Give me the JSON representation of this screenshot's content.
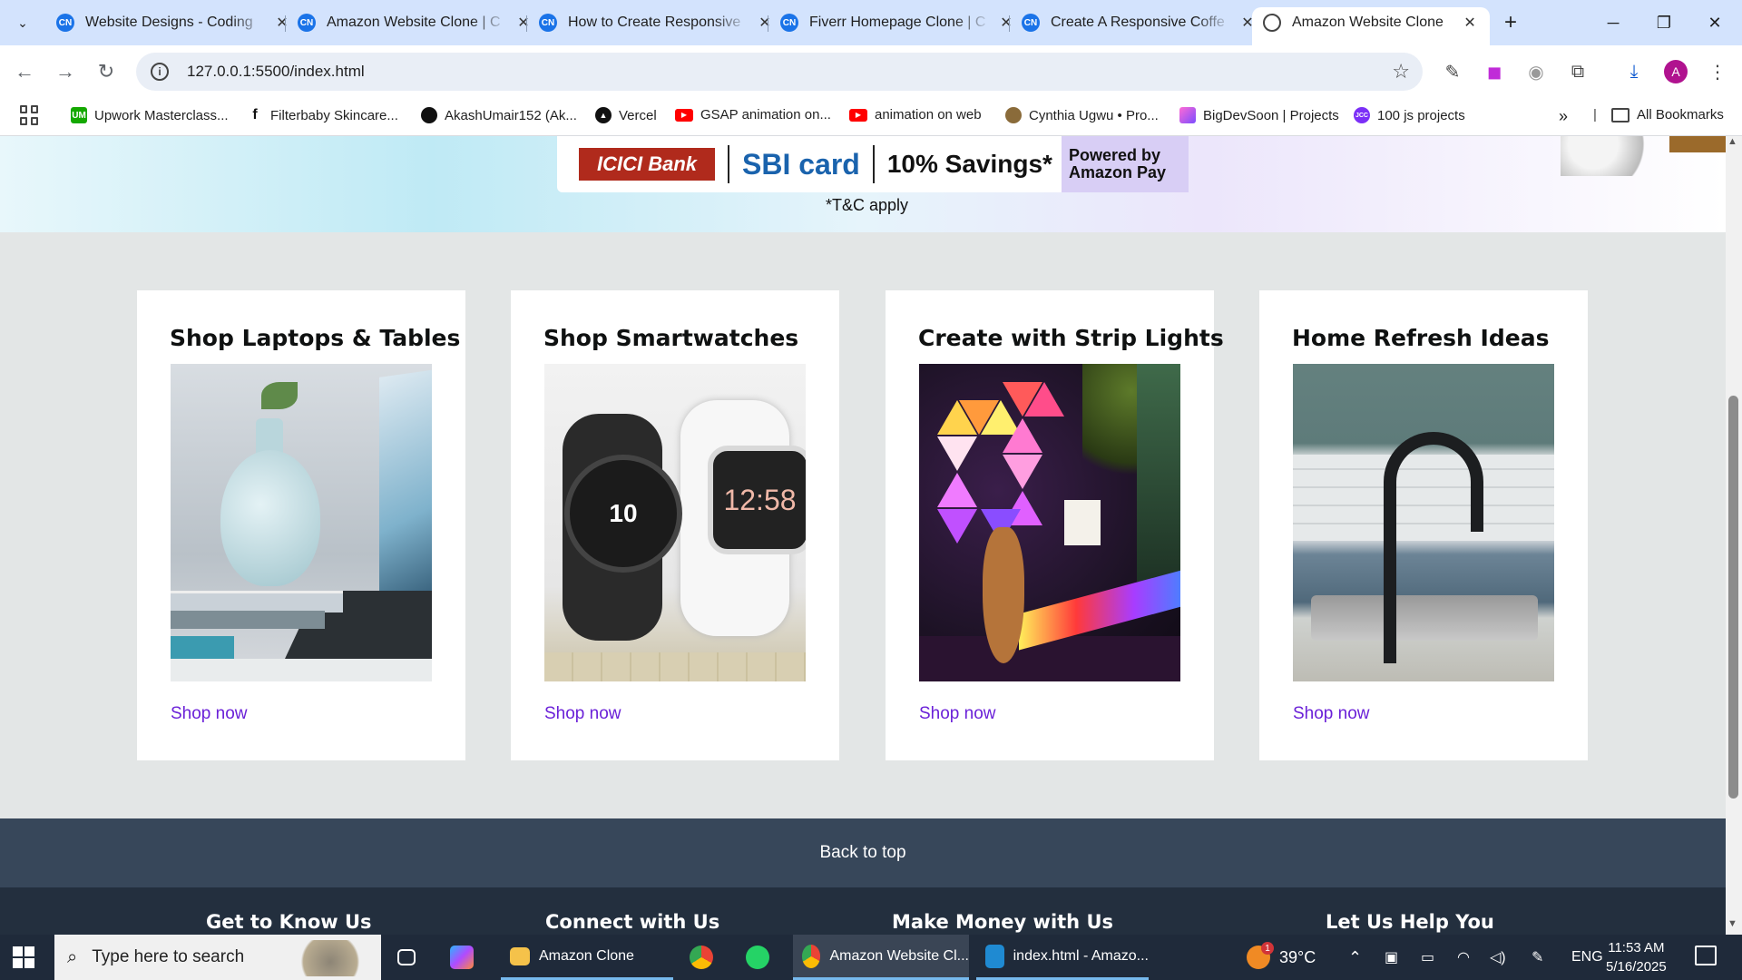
{
  "browser": {
    "tabs": [
      {
        "label": "Website Designs - Coding"
      },
      {
        "label": "Amazon Website Clone | C"
      },
      {
        "label": "How to Create Responsive"
      },
      {
        "label": "Fiverr Homepage Clone | C"
      },
      {
        "label": "Create A Responsive Coffe"
      },
      {
        "label": "Amazon Website Clone"
      }
    ],
    "url": "127.0.0.1:5500/index.html",
    "profile_initial": "A",
    "bookmarks": [
      {
        "label": "Upwork Masterclass..."
      },
      {
        "label": "Filterbaby Skincare..."
      },
      {
        "label": "AkashUmair152 (Ak..."
      },
      {
        "label": "Vercel"
      },
      {
        "label": "GSAP animation on..."
      },
      {
        "label": "animation on web"
      },
      {
        "label": "Cynthia Ugwu • Pro..."
      },
      {
        "label": "BigDevSoon | Projects"
      },
      {
        "label": "100 js projects"
      }
    ],
    "all_bookmarks": "All Bookmarks",
    "bookmark_badges": {
      "upwork": "UM",
      "js": "JCC"
    }
  },
  "banner": {
    "icici": "ICICI Bank",
    "sbi": "SBI card",
    "savings": "10% Savings*",
    "pay_line1": "Powered by",
    "pay_line2": "Amazon Pay",
    "tc": "*T&C apply"
  },
  "cards": [
    {
      "title": "Shop Laptops & Tables",
      "link": "Shop now"
    },
    {
      "title": "Shop Smartwatches",
      "link": "Shop now",
      "watch_black": "10",
      "watch_white": "12:58"
    },
    {
      "title": "Create with Strip Lights",
      "link": "Shop now"
    },
    {
      "title": "Home Refresh Ideas",
      "link": "Shop now"
    }
  ],
  "footer": {
    "back_to_top": "Back to top",
    "columns": [
      "Get to Know Us",
      "Connect with Us",
      "Make Money with Us",
      "Let Us Help You"
    ]
  },
  "taskbar": {
    "search_placeholder": "Type here to search",
    "apps": [
      {
        "label": "Amazon Clone"
      },
      {
        "label": "Amazon Website Cl..."
      },
      {
        "label": "index.html - Amazo..."
      }
    ],
    "weather": "39°C",
    "weather_badge": "1",
    "language": "ENG",
    "time": "11:53 AM",
    "date": "5/16/2025"
  },
  "colors": {
    "link": "#6b21d8",
    "back_to_top_bg": "#37475a",
    "footer_bg": "#232f3e",
    "page_bg": "#e3e6e6"
  }
}
